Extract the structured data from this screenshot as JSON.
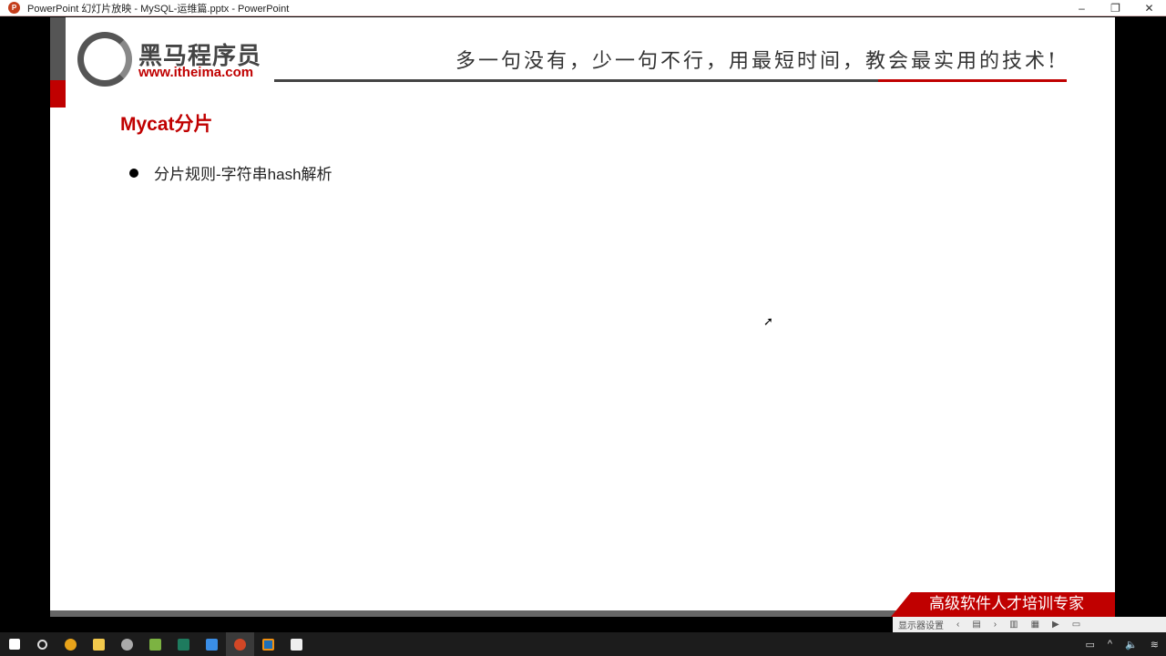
{
  "window": {
    "title": "PowerPoint 幻灯片放映  -  MySQL-运维篇.pptx - PowerPoint",
    "minimize": "–",
    "maximize": "❐",
    "close": "✕"
  },
  "slide": {
    "brand": "黑马程序员",
    "url": "www.itheima.com",
    "slogan": "多一句没有，少一句不行，用最短时间，教会最实用的技术!",
    "heading": "Mycat分片",
    "bullets": [
      "分片规则-字符串hash解析"
    ],
    "banner": "高级软件人才培训专家"
  },
  "showbar": {
    "display_settings": "显示器设置",
    "prev": "‹",
    "next": "›"
  },
  "colors": {
    "accent": "#c00000",
    "gray": "#555555"
  }
}
